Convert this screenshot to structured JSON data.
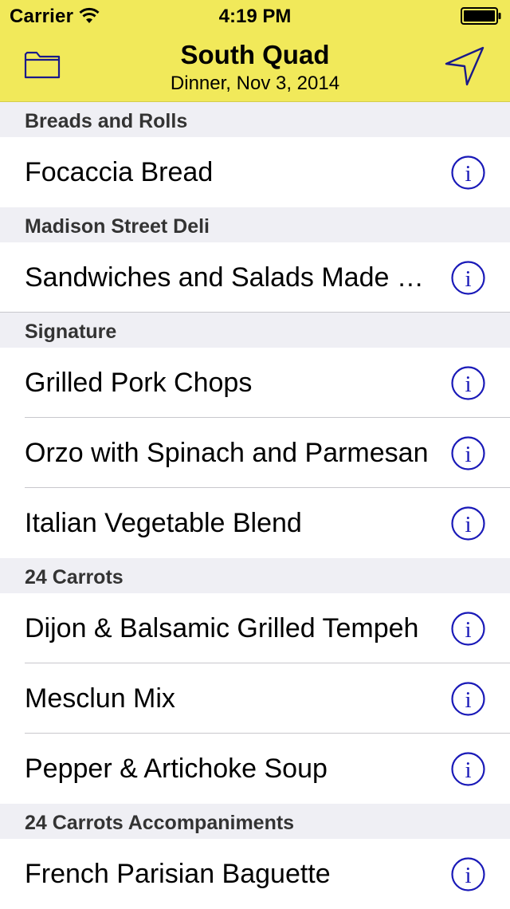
{
  "status_bar": {
    "carrier": "Carrier",
    "time": "4:19 PM"
  },
  "nav": {
    "title": "South Quad",
    "subtitle": "Dinner, Nov 3, 2014",
    "left_icon": "folder-icon",
    "right_icon": "location-arrow-icon"
  },
  "colors": {
    "header_bg": "#f1e95a",
    "section_bg": "#efeff4",
    "info_icon": "#1a1ab8"
  },
  "sections": [
    {
      "title": "Breads and Rolls",
      "items": [
        "Focaccia Bread"
      ]
    },
    {
      "title": "Madison Street Deli",
      "items": [
        "Sandwiches and Salads Made to Order"
      ]
    },
    {
      "title": "Signature",
      "items": [
        "Grilled Pork Chops",
        "Orzo with Spinach and Parmesan",
        "Italian Vegetable Blend"
      ]
    },
    {
      "title": "24 Carrots",
      "items": [
        "Dijon & Balsamic Grilled Tempeh",
        "Mesclun Mix",
        "Pepper & Artichoke Soup"
      ]
    },
    {
      "title": "24 Carrots Accompaniments",
      "items": [
        "French Parisian Baguette"
      ]
    }
  ]
}
